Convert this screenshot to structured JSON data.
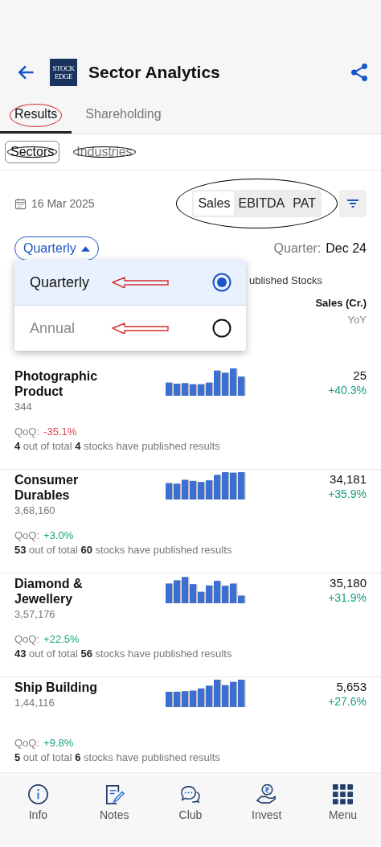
{
  "header": {
    "title": "Sector Analytics",
    "logo_lines": [
      "STOCK",
      "EDGE"
    ]
  },
  "tabs": [
    {
      "label": "Results",
      "selected": true,
      "circled": true
    },
    {
      "label": "Shareholding",
      "selected": false
    }
  ],
  "chips": [
    {
      "label": "Sectors",
      "selected": true,
      "circled": true
    },
    {
      "label": "Industries",
      "selected": false,
      "circled": true
    }
  ],
  "date": "16 Mar 2025",
  "metrics": {
    "circled": true,
    "options": [
      {
        "label": "Sales",
        "selected": true
      },
      {
        "label": "EBITDA",
        "selected": false
      },
      {
        "label": "PAT",
        "selected": false
      }
    ]
  },
  "period": {
    "label": "Quarterly",
    "expanded": true
  },
  "quarter": {
    "label": "Quarter:",
    "value": "Dec 24"
  },
  "published_note": "ublished Stocks",
  "dropdown": [
    {
      "label": "Quarterly",
      "selected": true,
      "arrow": true
    },
    {
      "label": "Annual",
      "selected": false,
      "arrow": true
    }
  ],
  "column_header": {
    "title": "Sales (Cr.)",
    "subtitle": "YoY"
  },
  "rows": [
    {
      "name": "Photographic Product",
      "value": "344",
      "sales": "25",
      "yoy": "+40.3%",
      "qoq_label": "QoQ:",
      "qoq": "-35.1%",
      "color": "#e0405a",
      "note": "**4** out of total **4** stocks have published results"
    },
    {
      "name": "Consumer Durables",
      "value": "3,68,160",
      "sales": "34,181",
      "yoy": "+35.9%",
      "qoq_label": "QoQ:",
      "qoq": "+3.0%",
      "color": "#17a07f",
      "note": "**53** out of total **60** stocks have published results"
    },
    {
      "name": "Diamond & Jewellery",
      "value": "3,57,176",
      "sales": "35,180",
      "yoy": "+31.9%",
      "qoq_label": "QoQ:",
      "qoq": "+22.5%",
      "color": "#17a07f",
      "note": "**43** out of total **56** stocks have published results"
    },
    {
      "name": "Ship Building",
      "value": "1,44,116",
      "sales": "5,653",
      "yoy": "+27.6%",
      "qoq_label": "QoQ:",
      "qoq": "+9.8%",
      "color": "#17a07f",
      "note": "**5** out of total **6** stocks have published results"
    }
  ],
  "nav": [
    {
      "label": "Info",
      "kind": "info"
    },
    {
      "label": "Notes",
      "kind": "notes"
    },
    {
      "label": "Club",
      "kind": "club"
    },
    {
      "label": "Invest",
      "kind": "invest"
    },
    {
      "label": "Menu",
      "kind": "menu"
    }
  ]
}
